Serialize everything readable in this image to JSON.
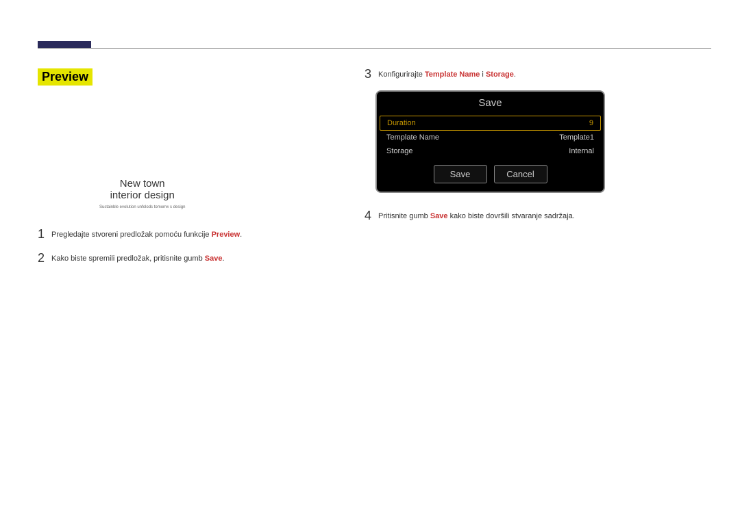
{
  "section": {
    "title": "Preview"
  },
  "preview": {
    "line1": "New town",
    "line2": "interior design",
    "subtext": "Sustainble evolution unfolods tomorrw s design"
  },
  "steps": {
    "s1": {
      "num": "1",
      "prefix": "Pregledajte stvoreni predložak pomoću funkcije ",
      "hl": "Preview",
      "suffix": "."
    },
    "s2": {
      "num": "2",
      "prefix": "Kako biste spremili predložak, pritisnite gumb ",
      "hl": "Save",
      "suffix": "."
    },
    "s3": {
      "num": "3",
      "prefix": "Konfigurirajte ",
      "hl1": "Template Name",
      "mid": " i ",
      "hl2": "Storage",
      "suffix": "."
    },
    "s4": {
      "num": "4",
      "prefix": "Pritisnite gumb ",
      "hl": "Save",
      "suffix": " kako biste dovršili stvaranje sadržaja."
    }
  },
  "dialog": {
    "title": "Save",
    "duration_label": "Duration",
    "duration_value": "9",
    "template_name_label": "Template Name",
    "template_name_value": "Template1",
    "storage_label": "Storage",
    "storage_value": "Internal",
    "save_btn": "Save",
    "cancel_btn": "Cancel"
  }
}
